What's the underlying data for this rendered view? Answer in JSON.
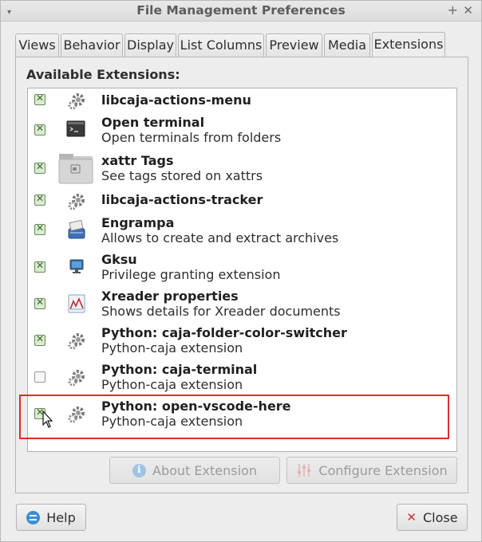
{
  "window": {
    "title": "File Management Preferences",
    "menu_glyph": "▾",
    "maximize_glyph": "+",
    "close_glyph": "✕"
  },
  "tabs": [
    {
      "label": "Views"
    },
    {
      "label": "Behavior"
    },
    {
      "label": "Display"
    },
    {
      "label": "List Columns"
    },
    {
      "label": "Preview"
    },
    {
      "label": "Media"
    },
    {
      "label": "Extensions",
      "active": true
    }
  ],
  "extensions": {
    "heading": "Available Extensions:",
    "items": [
      {
        "name": "libcaja-actions-menu",
        "description": "",
        "enabled": true,
        "icon": "gear-icon"
      },
      {
        "name": "Open terminal",
        "description": "Open terminals from folders",
        "enabled": true,
        "icon": "terminal-icon"
      },
      {
        "name": "xattr Tags",
        "description": "See tags stored on xattrs",
        "enabled": true,
        "icon": "folder-icon"
      },
      {
        "name": "libcaja-actions-tracker",
        "description": "",
        "enabled": true,
        "icon": "gear-icon"
      },
      {
        "name": "Engrampa",
        "description": "Allows to create and extract archives",
        "enabled": true,
        "icon": "archive-icon"
      },
      {
        "name": "Gksu",
        "description": "Privilege granting extension",
        "enabled": true,
        "icon": "monitor-icon"
      },
      {
        "name": "Xreader properties",
        "description": "Shows details for Xreader documents",
        "enabled": true,
        "icon": "document-viewer-icon"
      },
      {
        "name": "Python: caja-folder-color-switcher",
        "description": "Python-caja extension",
        "enabled": true,
        "icon": "gear-icon"
      },
      {
        "name": "Python: caja-terminal",
        "description": "Python-caja extension",
        "enabled": false,
        "icon": "gear-icon"
      },
      {
        "name": "Python: open-vscode-here",
        "description": "Python-caja extension",
        "enabled": true,
        "icon": "gear-icon"
      }
    ]
  },
  "actions": {
    "about_label": "About Extension",
    "configure_label": "Configure Extension"
  },
  "footer": {
    "help_label": "Help",
    "close_label": "Close"
  },
  "colors": {
    "highlight": "#e02b2b",
    "info_blue": "#3a8ed6",
    "close_red": "#d32f2f"
  }
}
